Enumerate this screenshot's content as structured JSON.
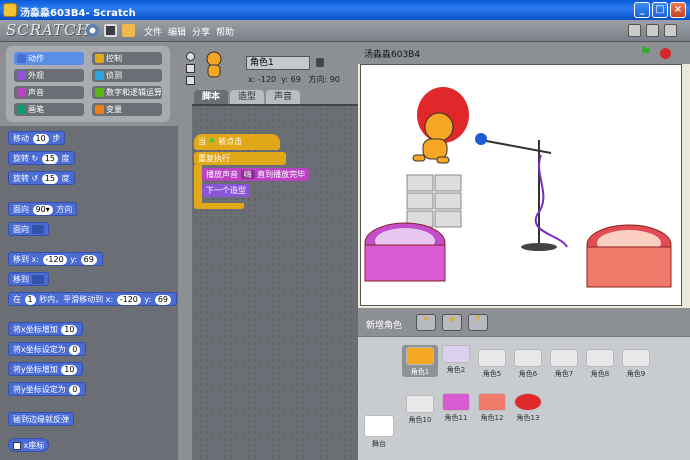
{
  "window": {
    "title": "汤淼淼603B4- Scratch"
  },
  "menubar": {
    "logo": "SCRATCH",
    "items": [
      {
        "label": "文件"
      },
      {
        "label": "编辑"
      },
      {
        "label": "分享"
      },
      {
        "label": "帮助"
      }
    ]
  },
  "categories": [
    {
      "label": "动作",
      "color": "#4a6cd4",
      "selected": true
    },
    {
      "label": "控制",
      "color": "#e1a91a",
      "selected": false
    },
    {
      "label": "外观",
      "color": "#8a55d7",
      "selected": false
    },
    {
      "label": "侦测",
      "color": "#2ca5e2",
      "selected": false
    },
    {
      "label": "声音",
      "color": "#bb42c3",
      "selected": false
    },
    {
      "label": "数字和逻辑运算",
      "color": "#5cb712",
      "selected": false
    },
    {
      "label": "画笔",
      "color": "#0e9a6c",
      "selected": false
    },
    {
      "label": "变量",
      "color": "#ee7d16",
      "selected": false
    }
  ],
  "palette": {
    "move": {
      "pre": "移动",
      "val": "10",
      "post": "步"
    },
    "turn_right": {
      "pre": "旋转",
      "val": "15",
      "post": "度"
    },
    "turn_left": {
      "pre": "旋转",
      "val": "15",
      "post": "度"
    },
    "point_dir": {
      "pre": "面向",
      "val": "90▾",
      "post": "方向"
    },
    "point_towards": {
      "pre": "面向"
    },
    "goto_xy": {
      "pre": "移到 x:",
      "x": "-120",
      "ylab": "y:",
      "y": "69"
    },
    "goto": {
      "pre": "移到"
    },
    "glide": {
      "pre": "在",
      "secs": "1",
      "mid": "秒内，平滑移动到 x:",
      "x": "-120",
      "ylab": "y:",
      "y": "69"
    },
    "change_x": {
      "pre": "将x坐标增加",
      "val": "10"
    },
    "set_x": {
      "pre": "将x坐标设定为",
      "val": "0"
    },
    "change_y": {
      "pre": "将y坐标增加",
      "val": "10"
    },
    "set_y": {
      "pre": "将y坐标设定为",
      "val": "0"
    },
    "bounce": {
      "label": "碰到边缘就反弹"
    },
    "xpos": {
      "label": "x座标"
    }
  },
  "sprite": {
    "name": "角色1",
    "x_label": "x:",
    "x": "-120",
    "y_label": "y:",
    "y": "69",
    "dir_label": "方向:",
    "dir": "90"
  },
  "tabs": [
    {
      "label": "脚本",
      "active": true
    },
    {
      "label": "造型",
      "active": false
    },
    {
      "label": "声音",
      "active": false
    }
  ],
  "script": {
    "hat_pre": "当",
    "hat_post": "被点击",
    "forever": "重复执行",
    "play_pre": "播放声音",
    "play_sound": "嗨",
    "play_post": "直到播放完毕",
    "next_costume": "下一个造型"
  },
  "stage": {
    "title": "汤淼淼603B4"
  },
  "coords": {
    "x_label": "x:",
    "x": "186",
    "y_label": "y:",
    "y": "91"
  },
  "new_sprite": {
    "label": "新增角色"
  },
  "sprites": [
    {
      "name": "角色1",
      "selected": true
    },
    {
      "name": "角色2"
    },
    {
      "name": "角色5"
    },
    {
      "name": "角色6"
    },
    {
      "name": "角色7"
    },
    {
      "name": "角色8"
    },
    {
      "name": "角色9"
    },
    {
      "name": "角色10"
    },
    {
      "name": "角色11"
    },
    {
      "name": "角色12"
    },
    {
      "name": "角色13"
    }
  ],
  "stage_thumb": {
    "label": "舞台"
  },
  "colors": {
    "motion": "#4a6cd4",
    "control": "#e1a91a",
    "sound": "#bb42c3",
    "looks": "#8a55d7"
  },
  "icons": [
    "flag-icon",
    "stop-icon",
    "globe-icon",
    "save-icon",
    "share-icon",
    "lock-icon",
    "paint-new-sprite-icon",
    "star-sprite-icon",
    "random-sprite-icon"
  ]
}
